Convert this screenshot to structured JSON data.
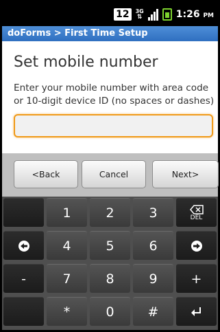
{
  "status_bar": {
    "notification_badge": "12",
    "network_type": "3G",
    "time": "1:26",
    "meridiem": "PM",
    "battery_color": "#7dd22e"
  },
  "title_bar": {
    "text": "doForms > First Time Setup"
  },
  "form": {
    "heading": "Set mobile number",
    "instructions": "Enter your mobile number with area code or 10-digit device ID (no spaces or dashes)",
    "input_value": ""
  },
  "buttons": {
    "back": "<Back",
    "cancel": "Cancel",
    "next": "Next>"
  },
  "keyboard": {
    "row1": [
      "",
      "1",
      "2",
      "3",
      "DEL"
    ],
    "row2": [
      "left-arrow",
      "4",
      "5",
      "6",
      "right-arrow"
    ],
    "row3": [
      "-",
      "7",
      "8",
      "9",
      "+"
    ],
    "row4": [
      "",
      "*",
      "0",
      "#",
      "enter"
    ],
    "labels": {
      "k1": "1",
      "k2": "2",
      "k3": "3",
      "k4": "4",
      "k5": "5",
      "k6": "6",
      "k7": "7",
      "k8": "8",
      "k9": "9",
      "k0": "0",
      "star": "*",
      "hash": "#",
      "minus": "-",
      "plus": "+",
      "del": "DEL"
    }
  },
  "colors": {
    "title_bar": "#3a7ac8",
    "input_focus_border": "#f09a1a",
    "button_bar": "#bfbfbf",
    "keyboard_bg": "#4f4f4f"
  }
}
